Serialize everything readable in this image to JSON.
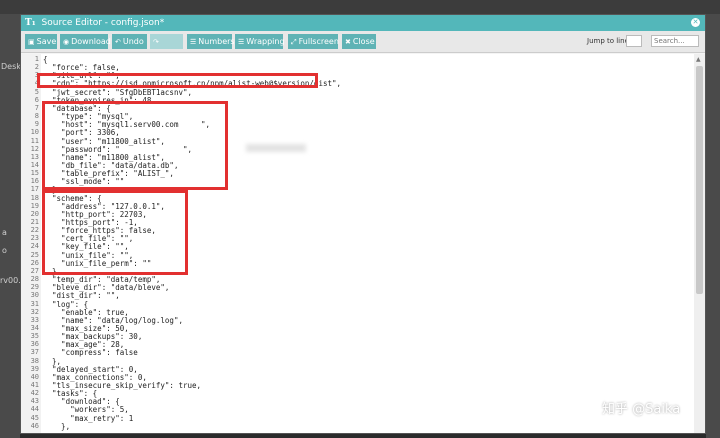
{
  "window": {
    "title": "Source Editor - config.json*",
    "logo": "T₁"
  },
  "toolbar": {
    "save": "Save",
    "download": "Download",
    "undo": "Undo",
    "redo": "",
    "numbers": "Numbers",
    "wrapping": "Wrapping",
    "fullscreen": "Fullscreen",
    "close": "Close",
    "jump_label": "Jump to line",
    "search_placeholder": "Search..."
  },
  "background": {
    "snippets": [
      "Desk",
      "a",
      "o",
      "rv00.n"
    ]
  },
  "code_lines": [
    {
      "n": "1",
      "text": "{"
    },
    {
      "n": "2",
      "text": "  \"force\": false,"
    },
    {
      "n": "3",
      "text": "  \"site_url\": \"\","
    },
    {
      "n": "4",
      "text": "  \"cdn\": \"https://jsd.onmicrosoft.cn/npm/alist-web@$version/dist\","
    },
    {
      "n": "5",
      "text": "  \"jwt_secret\": \"SfgDbEBT1acsnv\","
    },
    {
      "n": "6",
      "text": "  \"token_expires_in\": 48,"
    },
    {
      "n": "7",
      "text": "  \"database\": {"
    },
    {
      "n": "8",
      "text": "    \"type\": \"mysql\","
    },
    {
      "n": "9",
      "text": "    \"host\": \"mysql1.serv00.com     \","
    },
    {
      "n": "10",
      "text": "    \"port\": 3306,"
    },
    {
      "n": "11",
      "text": "    \"user\": \"m11800_alist\","
    },
    {
      "n": "12",
      "text": "    \"password\": \"              \","
    },
    {
      "n": "13",
      "text": "    \"name\": \"m11800_alist\","
    },
    {
      "n": "14",
      "text": "    \"db_file\": \"data/data.db\","
    },
    {
      "n": "15",
      "text": "    \"table_prefix\": \"ALIST_\","
    },
    {
      "n": "16",
      "text": "    \"ssl_mode\": \"\""
    },
    {
      "n": "17",
      "text": "  },"
    },
    {
      "n": "18",
      "text": "  \"scheme\": {"
    },
    {
      "n": "19",
      "text": "    \"address\": \"127.0.0.1\","
    },
    {
      "n": "20",
      "text": "    \"http_port\": 22703,"
    },
    {
      "n": "21",
      "text": "    \"https_port\": -1,"
    },
    {
      "n": "22",
      "text": "    \"force_https\": false,"
    },
    {
      "n": "23",
      "text": "    \"cert_file\": \"\","
    },
    {
      "n": "24",
      "text": "    \"key_file\": \"\","
    },
    {
      "n": "25",
      "text": "    \"unix_file\": \"\","
    },
    {
      "n": "26",
      "text": "    \"unix_file_perm\": \"\""
    },
    {
      "n": "27",
      "text": "  },"
    },
    {
      "n": "28",
      "text": "  \"temp_dir\": \"data/temp\","
    },
    {
      "n": "29",
      "text": "  \"bleve_dir\": \"data/bleve\","
    },
    {
      "n": "30",
      "text": "  \"dist_dir\": \"\","
    },
    {
      "n": "31",
      "text": "  \"log\": {"
    },
    {
      "n": "32",
      "text": "    \"enable\": true,"
    },
    {
      "n": "33",
      "text": "    \"name\": \"data/log/log.log\","
    },
    {
      "n": "34",
      "text": "    \"max_size\": 50,"
    },
    {
      "n": "35",
      "text": "    \"max_backups\": 30,"
    },
    {
      "n": "36",
      "text": "    \"max_age\": 28,"
    },
    {
      "n": "37",
      "text": "    \"compress\": false"
    },
    {
      "n": "38",
      "text": "  },"
    },
    {
      "n": "39",
      "text": "  \"delayed_start\": 0,"
    },
    {
      "n": "40",
      "text": "  \"max_connections\": 0,"
    },
    {
      "n": "41",
      "text": "  \"tls_insecure_skip_verify\": true,"
    },
    {
      "n": "42",
      "text": "  \"tasks\": {"
    },
    {
      "n": "43",
      "text": "    \"download\": {"
    },
    {
      "n": "44",
      "text": "      \"workers\": 5,"
    },
    {
      "n": "45",
      "text": "      \"max_retry\": 1"
    },
    {
      "n": "46",
      "text": "    },"
    }
  ],
  "watermark": "知乎 @Saika",
  "colors": {
    "accent": "#53b7ba",
    "button": "#5fb3b5",
    "highlight": "#e23030"
  }
}
